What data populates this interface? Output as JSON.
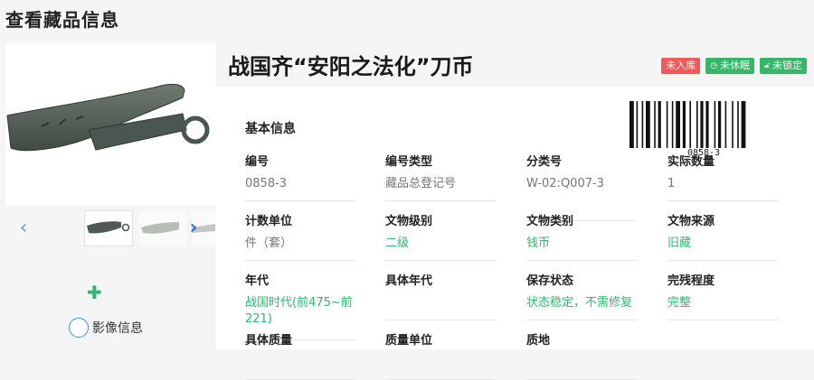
{
  "page": {
    "title": "查看藏品信息"
  },
  "artifact": {
    "title": "战国齐“安阳之法化”刀币",
    "badges": [
      {
        "label": "未入库",
        "color": "#f05a5a",
        "icon": ""
      },
      {
        "label": "未休眠",
        "color": "#34b768",
        "icon": "clock-icon"
      },
      {
        "label": "未锁定",
        "color": "#34b768",
        "icon": "lock-icon"
      }
    ],
    "barcode_text": "0858-3"
  },
  "section": {
    "title": "基本信息"
  },
  "fields": [
    {
      "label": "编号",
      "value": "0858-3",
      "style": "gray"
    },
    {
      "label": "编号类型",
      "value": "藏品总登记号",
      "style": "gray"
    },
    {
      "label": "分类号",
      "value": "W-02:Q007-3",
      "style": "gray"
    },
    {
      "label": "实际数量",
      "value": "1",
      "style": "gray"
    },
    {
      "label": "计数单位",
      "value": "件（套）",
      "style": "gray"
    },
    {
      "label": "文物级别",
      "value": "二级",
      "style": "green"
    },
    {
      "label": "文物类别",
      "value": "钱币",
      "style": "green"
    },
    {
      "label": "文物来源",
      "value": "旧藏",
      "style": "green"
    },
    {
      "label": "年代",
      "value": "战国时代(前475~前221)",
      "style": "green"
    },
    {
      "label": "具体年代",
      "value": "",
      "style": "gray"
    },
    {
      "label": "保存状态",
      "value": "状态稳定，不需修复",
      "style": "green"
    },
    {
      "label": "完残程度",
      "value": "完整",
      "style": "green"
    },
    {
      "label": "具体质量",
      "value": "",
      "style": "gray"
    },
    {
      "label": "质量单位",
      "value": "",
      "style": "gray"
    },
    {
      "label": "质地",
      "value": "",
      "style": "gray"
    }
  ],
  "gallery": {
    "prev_icon": "chevron-left-icon",
    "next_icon": "chevron-right-icon"
  },
  "sidebar": {
    "add_icon": "plus-icon",
    "image_info_label": "影像信息"
  }
}
